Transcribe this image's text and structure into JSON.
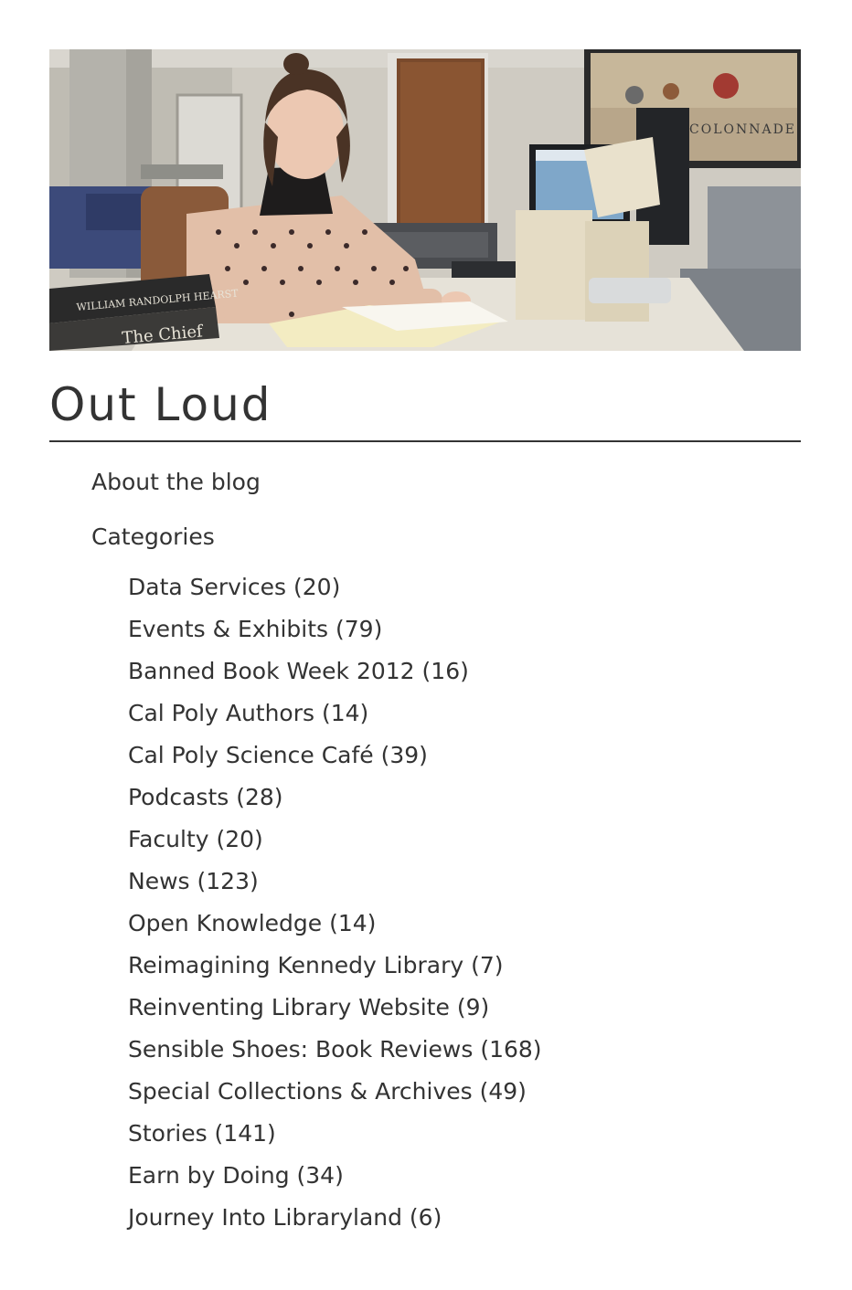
{
  "banner": {
    "alt": "Library staff member reading archival materials at a desk",
    "book_spine_1": "WILLIAM RANDOLPH HEARST",
    "book_spine_2": "The Chief",
    "poster_text": "COLONNADE"
  },
  "blog_title": "Out Loud",
  "nav": {
    "about_label": "About the blog",
    "categories_label": "Categories"
  },
  "categories": [
    {
      "name": "Data Services",
      "count": "(20)",
      "label": "Data Services (20)"
    },
    {
      "name": "Events & Exhibits",
      "count": "(79)",
      "label": "Events & Exhibits (79)"
    },
    {
      "name": "Banned Book Week 2012",
      "count": "(16)",
      "label": "Banned Book Week 2012 (16)"
    },
    {
      "name": "Cal Poly Authors",
      "count": "(14)",
      "label": "Cal Poly Authors (14)"
    },
    {
      "name": "Cal Poly Science Café",
      "count": "(39)",
      "label": "Cal Poly Science Café (39)"
    },
    {
      "name": "Podcasts",
      "count": "(28)",
      "label": "Podcasts (28)"
    },
    {
      "name": "Faculty",
      "count": "(20)",
      "label": "Faculty (20)"
    },
    {
      "name": "News",
      "count": "(123)",
      "label": "News (123)"
    },
    {
      "name": "Open Knowledge",
      "count": "(14)",
      "label": "Open Knowledge (14)"
    },
    {
      "name": "Reimagining Kennedy Library",
      "count": "(7)",
      "label": "Reimagining Kennedy Library (7)"
    },
    {
      "name": "Reinventing Library Website",
      "count": "(9)",
      "label": "Reinventing Library Website (9)"
    },
    {
      "name": "Sensible Shoes: Book Reviews",
      "count": "(168)",
      "label": "Sensible Shoes: Book Reviews (168)"
    },
    {
      "name": "Special Collections & Archives",
      "count": "(49)",
      "label": "Special Collections & Archives (49)"
    },
    {
      "name": "Stories",
      "count": "(141)",
      "label": "Stories (141)"
    },
    {
      "name": "Earn by Doing",
      "count": "(34)",
      "label": "Earn by Doing (34)"
    },
    {
      "name": "Journey Into Libraryland",
      "count": "(6)",
      "label": "Journey Into Libraryland (6)"
    }
  ]
}
